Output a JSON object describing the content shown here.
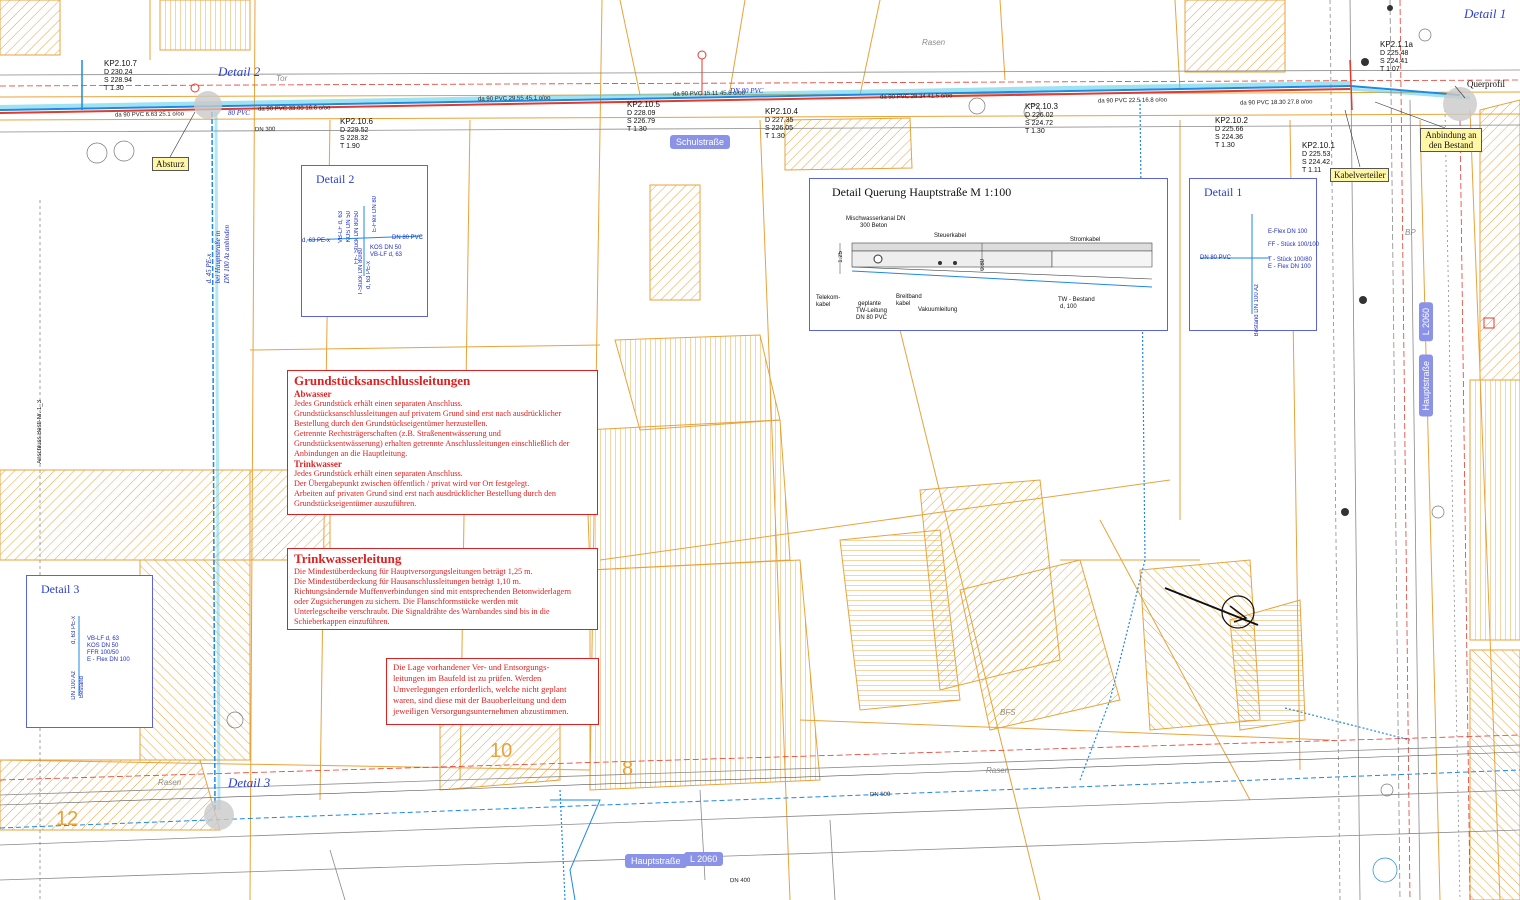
{
  "colors": {
    "parcel": "#e8a33a",
    "pipe_blue": "#1e88e5",
    "pipe_cyan": "#3fc6e6",
    "pipe_red": "#e23b2e",
    "note_red": "#e02020",
    "detail_blue": "#2a3fd0",
    "highlight_yellow": "#fff7a6",
    "road_tag": "#8a93e8"
  },
  "detail_tags": {
    "d1": "Detail 1",
    "d2": "Detail 2",
    "d3": "Detail 3"
  },
  "callouts": {
    "absturz": "Absturz",
    "querprofil": "Querprofil",
    "anbindung": "Anbindung an den Bestand",
    "kabelverteiler": "Kabelverteiler"
  },
  "roads": {
    "schulstrasse": "Schulstraße",
    "hauptstrasse_bottom": "Hauptstraße",
    "l2060_bottom": "L 2060",
    "hauptstrasse_right": "Hauptstraße",
    "l2060_right": "L 2060"
  },
  "kp_points": [
    {
      "name": "KP2.10.7",
      "d": "D 230.24",
      "s": "S 228.94",
      "t": "T 1.30"
    },
    {
      "name": "KP2.10.6",
      "d": "D 229.52",
      "s": "S 228.32",
      "t": "T 1.90"
    },
    {
      "name": "KP2.10.5",
      "d": "D 228.09",
      "s": "S 226.79",
      "t": "T 1.30"
    },
    {
      "name": "KP2.10.4",
      "d": "D 227.35",
      "s": "S 226.05",
      "t": "T 1.30"
    },
    {
      "name": "KP2.10.3",
      "d": "D 226.02",
      "s": "S 224.72",
      "t": "T 1.30"
    },
    {
      "name": "KP2.10.2",
      "d": "D 225.66",
      "s": "S 224.36",
      "t": "T 1.30"
    },
    {
      "name": "KP2.10.1",
      "d": "D 225.53",
      "s": "S 224.42",
      "t": "T 1.11"
    },
    {
      "name": "KP2.1.1a",
      "d": "D 225.48",
      "s": "S 224.41",
      "t": "T 1.07"
    }
  ],
  "pipe_labels": {
    "a": "da 90 PVC 6.63 25.1 o/oo",
    "b": "da 90 PVC 33.00 16.6 o/oo",
    "c": "da 90 PVC 29.55 45.1 o/oo",
    "d": "da 90 PVC 15.11 45.8 o/oo",
    "e": "da 90 PVC 28.34 41.5 o/oo",
    "f": "da 90 PVC 22.5 16.8 o/oo",
    "g": "da 90 PVC 18.30 27.8 o/oo",
    "dn80": "DN 80 PVC",
    "dn80_short": "80 PVC",
    "dn300": "DN 300",
    "dn500": "DN 500",
    "dn400": "DN 400"
  },
  "vertical_label": {
    "l1": "d. 45 PE-x",
    "l2": "bei Hauptstraße in",
    "l3": "DN 100 Az anbinden"
  },
  "left_edge_label": "Anschluss Bestl-Nr. 1_3",
  "gray_labels": {
    "tor": "Tor",
    "rosen_top": "Rasen",
    "rosen_bottom": "Rasen",
    "rosen_mid": "Rasen",
    "bp": "BP",
    "bfs": "BFS"
  },
  "field_numbers": {
    "n1": "10",
    "n2": "8",
    "n3": "12"
  },
  "notes": {
    "grundstueck": {
      "title": "Grundstücksanschlussleitungen",
      "abwasser_heading": "Abwasser",
      "abwasser": [
        "Jedes Grundstück erhält einen separaten Anschluss.",
        "Grundstücksanschlussleitungen auf privatem Grund sind erst nach ausdrücklicher",
        "Bestellung durch den Grundstückseigentümer herzustellen.",
        "Getrennte Rechtsträgerschaften (z.B. Straßenentwässerung und",
        "Grundstücksentwässerung) erhalten getrennte Anschlussleitungen einschließlich der",
        "Anbindungen an die Hauptleitung."
      ],
      "trinkwasser_heading": "Trinkwasser",
      "trinkwasser": [
        "Jedes Grundstück erhält einen separaten Anschluss.",
        "Der Übergabepunkt zwischen öffentlich / privat wird vor Ort festgelegt.",
        "Arbeiten auf privaten Grund sind erst nach ausdrücklicher Bestellung durch den",
        "Grundstückseigentümer auszuführen."
      ]
    },
    "trinkwasserleitung": {
      "title": "Trinkwasserleitung",
      "lines": [
        "Die Mindestüberdeckung für Hauptversorgungsleitungen beträgt 1,25 m.",
        "Die Mindestüberdeckung für Hausanschlussleitungen beträgt 1,10 m.",
        "Richtungsändernde Muffenverbindungen sind mit entsprechenden Betonwiderlagern",
        "oder Zugsicherungen zu sichern. Die Flanschformstücke werden mit",
        "Unterlegscheibe verschraubt. Die Signaldrähte des Warnbandes sind bis in die",
        "Schieberkappen einzuführen."
      ]
    },
    "lage": {
      "lines": [
        "Die Lage vorhandener Ver- und Entsorgungs-",
        "leitungen im Baufeld ist zu prüfen. Werden",
        "Umverlegungen erforderlich, welche nicht geplant",
        "waren, sind diese mit der Bauoberleitung und dem",
        "jeweiligen Versorgungsunternehmen abzustimmen."
      ]
    }
  },
  "detail_boxes": {
    "d2": {
      "title": "Detail 2",
      "labels": [
        "d, 63 PE-x",
        "VB-LF d, 63",
        "KOS DN 50",
        "FF- Stück DN 80/50",
        "E-Flex DN 80",
        "DN 80 PVC",
        "KOS DN 50",
        "VB-LF d, 63",
        "T-Stück DN 80/80",
        "d, 63 PE-x"
      ]
    },
    "d1": {
      "title": "Detail 1",
      "labels": [
        "E-Flex DN 100",
        "FF - Stück 100/100",
        "T - Stück 100/80",
        "E - Flex DN 100",
        "DN 80 PVC",
        "Bestand DN 100 Az"
      ]
    },
    "d3": {
      "title": "Detail 3",
      "labels": [
        "d, 63 PE-x",
        "VB-LF d, 63",
        "KOS DN 50",
        "FFR 100/50",
        "E - Flex DN 100",
        "DN 100 Az",
        "Bestand"
      ]
    },
    "quer": {
      "title": "Detail Querung Hauptstraße M 1:100",
      "labels": {
        "misch": "Mischwasserkanal DN",
        "misch2": "300 Beton",
        "steuer": "Steuerkabel",
        "strom": "Stromkabel",
        "telekom": "Telekom-",
        "telekom2": "kabel",
        "geplante": "geplante",
        "tw": "TW-Leitung",
        "dn80": "DN 80 PVC",
        "breitband": "Breitband",
        "breitband2": "kabel",
        "vakuum": "Vakuumleitung",
        "twb": "TW - Bestand",
        "twb2": "d, 100",
        "dim1": "1.25",
        "dim2": "0.80"
      }
    }
  }
}
